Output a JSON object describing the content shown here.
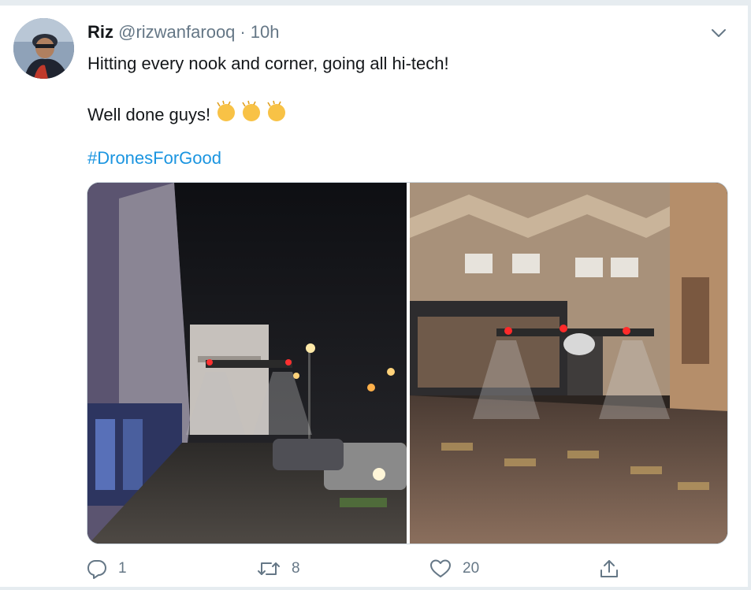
{
  "tweet": {
    "display_name": "Riz",
    "handle": "@rizwanfarooq",
    "separator": "·",
    "time": "10h",
    "text_line1": "Hitting every nook and corner, going all hi-tech!",
    "text_line2": "Well done guys!",
    "emoji": "clapping-hands-emoji",
    "emoji_count": 3,
    "hashtag": "#DronesForGood"
  },
  "actions": {
    "reply_count": "1",
    "retweet_count": "8",
    "like_count": "20"
  },
  "colors": {
    "link": "#1b95e0",
    "muted": "#657786",
    "text": "#14171a",
    "border": "#e6ecf0"
  },
  "icons": [
    "avatar",
    "chevron-down-icon",
    "reply-icon",
    "retweet-icon",
    "like-icon",
    "share-icon"
  ]
}
